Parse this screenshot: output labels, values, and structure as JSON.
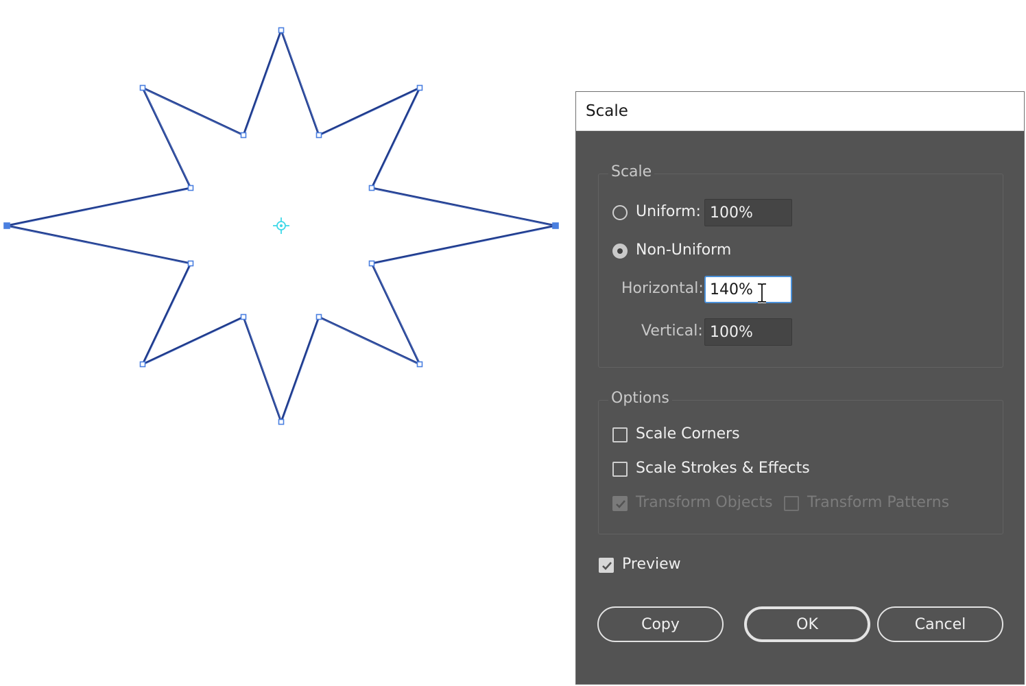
{
  "dialog": {
    "title": "Scale",
    "scale_group": {
      "legend": "Scale",
      "uniform_label": "Uniform:",
      "uniform_value": "100%",
      "uniform_selected": false,
      "non_uniform_label": "Non-Uniform",
      "non_uniform_selected": true,
      "horizontal_label": "Horizontal:",
      "horizontal_value": "140%",
      "vertical_label": "Vertical:",
      "vertical_value": "100%"
    },
    "options_group": {
      "legend": "Options",
      "scale_corners_label": "Scale Corners",
      "scale_corners_checked": false,
      "scale_strokes_label": "Scale Strokes & Effects",
      "scale_strokes_checked": false,
      "transform_objects_label": "Transform Objects",
      "transform_objects_checked": true,
      "transform_patterns_label": "Transform Patterns",
      "transform_patterns_checked": false
    },
    "preview_label": "Preview",
    "preview_checked": true,
    "buttons": {
      "copy": "Copy",
      "ok": "OK",
      "cancel": "Cancel"
    }
  },
  "colors": {
    "dialog_bg": "#535353",
    "path_stroke": "#1f3a8a",
    "anchor_color": "#4a7fe0",
    "center_point": "#3fd8e8",
    "focus_ring": "#4a90d9"
  },
  "canvas": {
    "shape": "eight-point-star",
    "center_icon": "center-point-icon"
  }
}
